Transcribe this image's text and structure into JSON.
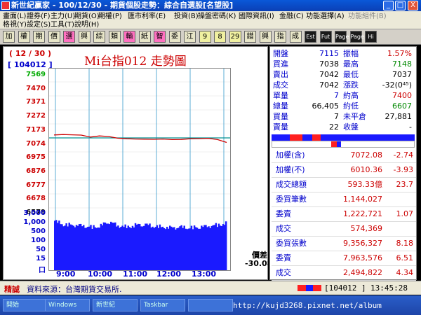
{
  "window": {
    "title": "新世紀贏家 - 100/12/30 - 期貨個股走勢：綜合自選股[名望股]",
    "buttons": [
      "_",
      "□",
      "X"
    ]
  },
  "menu": {
    "row1": [
      "畫面(L)",
      "證券(F)",
      "主力(U)",
      "期貨(O)",
      "期權(P)",
      "匯市利率(E)",
      "投資(B)",
      "操盤密碼(K)",
      "國際資訊(I)",
      "金融(C)",
      "功能選擇(A)",
      "功能組件(B)"
    ],
    "row2": [
      "格視(Y)",
      "設定(S)",
      "工具(T)",
      "說明(H)"
    ]
  },
  "toolbar": {
    "buttons": [
      "加",
      "權",
      "期",
      "價",
      "選",
      "興",
      "綜",
      "類",
      "輸",
      "紙",
      "智",
      "委",
      "江",
      "9",
      "8",
      "29",
      "錯",
      "興",
      "指",
      "成",
      "Est",
      "Fut",
      "Page",
      "Page",
      "Hi"
    ]
  },
  "chart": {
    "date": "( 12 / 30 )",
    "code": "[ 104012 ]",
    "title": "Mi台指012  走勢圖",
    "price_labels": [
      "7569",
      "7470",
      "7371",
      "7272",
      "7173",
      "7074",
      "6975",
      "6876",
      "6777",
      "6678",
      "6579"
    ],
    "volume_labels": [
      "3,000",
      "1,000",
      "500",
      "100",
      "50",
      "15",
      "口"
    ],
    "time_labels": [
      "9:00",
      "10:00",
      "11:00",
      "12:00",
      "13:00"
    ],
    "diff_label": "價差",
    "diff_value": "-30.08",
    "reference_price": 7074,
    "colors": {
      "price_line": "#cc0000",
      "volume": "#1a1aff",
      "grid": "#3399cc",
      "reference": "#009090"
    }
  },
  "chart_data": {
    "type": "line",
    "title": "Mi台指012  走勢圖",
    "x": [
      "9:00",
      "9:15",
      "9:30",
      "9:45",
      "10:00",
      "10:15",
      "10:30",
      "10:45",
      "11:00",
      "11:15",
      "11:30",
      "11:45",
      "12:00",
      "12:15",
      "12:30",
      "12:45",
      "13:00",
      "13:15",
      "13:30",
      "13:45"
    ],
    "series": [
      {
        "values": [
          7095,
          7098,
          7096,
          7094,
          7080,
          7088,
          7084,
          7072,
          7068,
          7066,
          7065,
          7064,
          7066,
          7062,
          7063,
          7068,
          7069,
          7071,
          7062,
          7042
        ]
      },
      {
        "values": [
          1100,
          700,
          650,
          600,
          500,
          550,
          1000,
          600,
          500,
          650,
          700,
          550,
          500,
          450,
          500,
          450,
          500,
          550,
          650,
          800
        ]
      }
    ],
    "ylim": [
      6579,
      7569
    ]
  },
  "info": {
    "rows": [
      {
        "l1": "開盤",
        "v1": "7115",
        "l2": "振幅",
        "v2": "1.57%",
        "c1": "#0000cc",
        "c2": "#cc0000"
      },
      {
        "l1": "買進",
        "v1": "7038",
        "l2": "最高",
        "v2": "7148",
        "c1": "#000000",
        "c2": "#008800"
      },
      {
        "l1": "賣出",
        "v1": "7042",
        "l2": "最低",
        "v2": "7037",
        "c1": "#000000",
        "c2": "#000000"
      },
      {
        "l1": "成交",
        "v1": "7042",
        "l2": "漲跌",
        "v2": "-32(0⁴⁵)",
        "c1": "#000000",
        "c2": "#000000"
      },
      {
        "l1": "單量",
        "v1": "7",
        "l2": "約高",
        "v2": "7400",
        "c1": "#0000cc",
        "c2": "#cc0000"
      },
      {
        "l1": "總量",
        "v1": "66,405",
        "l2": "約低",
        "v2": "6607",
        "c1": "#000000",
        "c2": "#008800"
      },
      {
        "l1": "買量",
        "v1": "7",
        "l2": "未平倉",
        "v2": "27,881",
        "c1": "#000000",
        "c2": "#000000"
      },
      {
        "l1": "賣量",
        "v1": "22",
        "l2": "收盤",
        "v2": "-",
        "c1": "#000000",
        "c2": "#000000"
      }
    ],
    "bottom": [
      {
        "label": "加權(含)",
        "val": "7072.08",
        "chg": "-2.74"
      },
      {
        "label": "加權(不)",
        "val": "6010.36",
        "chg": "-3.93"
      },
      {
        "label": "成交總額",
        "val": "593.33億",
        "chg": "23.7"
      },
      {
        "label": "委買筆數",
        "val": "1,144,027",
        "chg": ""
      },
      {
        "label": "委賣",
        "val": "1,222,721",
        "chg": "1.07"
      },
      {
        "label": "成交",
        "val": "574,369",
        "chg": ""
      },
      {
        "label": "委買張數",
        "val": "9,356,327",
        "chg": "8.18"
      },
      {
        "label": "委賣",
        "val": "7,963,576",
        "chg": "6.51"
      },
      {
        "label": "成交",
        "val": "2,494,822",
        "chg": "4.34"
      }
    ]
  },
  "status": {
    "badge": "精誠",
    "source": "資料來源：台灣期貨交易所.",
    "code": "[104012 ]",
    "time": "13:45:28"
  },
  "taskbar": {
    "items": [
      "開始",
      "Windows",
      "新世紀",
      "Taskbar",
      "",
      ""
    ],
    "url": "http://kujd3268.pixnet.net/album"
  }
}
